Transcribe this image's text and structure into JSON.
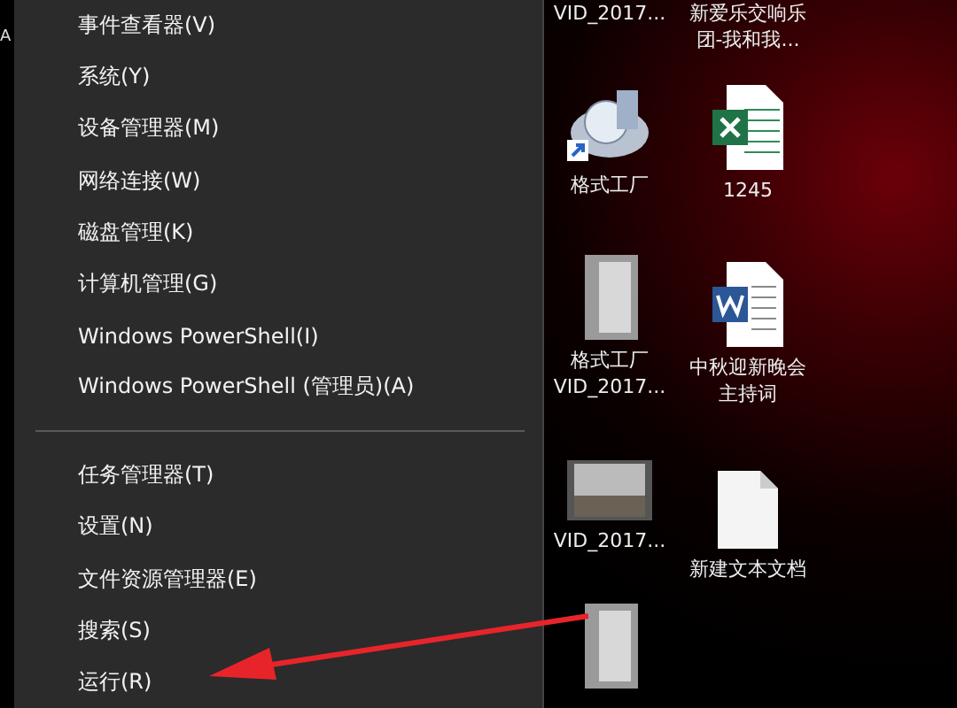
{
  "left_edge": {
    "text": "A"
  },
  "menu": {
    "items": [
      {
        "kind": "item",
        "label": "事件查看器(V)"
      },
      {
        "kind": "item",
        "label": "系统(Y)"
      },
      {
        "kind": "item",
        "label": "设备管理器(M)"
      },
      {
        "kind": "item",
        "label": "网络连接(W)"
      },
      {
        "kind": "item",
        "label": "磁盘管理(K)"
      },
      {
        "kind": "item",
        "label": "计算机管理(G)"
      },
      {
        "kind": "item",
        "label": "Windows PowerShell(I)"
      },
      {
        "kind": "item",
        "label": "Windows PowerShell (管理员)(A)"
      },
      {
        "kind": "separator"
      },
      {
        "kind": "item",
        "label": "任务管理器(T)"
      },
      {
        "kind": "item",
        "label": "设置(N)"
      },
      {
        "kind": "item",
        "label": "文件资源管理器(E)"
      },
      {
        "kind": "item",
        "label": "搜索(S)"
      },
      {
        "kind": "item",
        "label": "运行(R)"
      }
    ]
  },
  "desktop": {
    "columns": [
      [
        {
          "kind": "none",
          "labels": [
            "VID_2017..."
          ]
        },
        {
          "kind": "app",
          "labels": [
            "格式工厂"
          ]
        },
        {
          "kind": "photo",
          "labels": [
            "格式工厂",
            "VID_2017..."
          ]
        },
        {
          "kind": "video",
          "labels": [
            "VID_2017..."
          ]
        },
        {
          "kind": "photo"
        }
      ],
      [
        {
          "kind": "none",
          "labels": [
            "新爱乐交响乐",
            "团-我和我..."
          ]
        },
        {
          "kind": "excel",
          "labels": [
            "1245"
          ]
        },
        {
          "kind": "word",
          "labels": [
            "中秋迎新晚会",
            "主持词"
          ]
        },
        {
          "kind": "text",
          "labels": [
            "新建文本文档"
          ]
        }
      ]
    ]
  }
}
